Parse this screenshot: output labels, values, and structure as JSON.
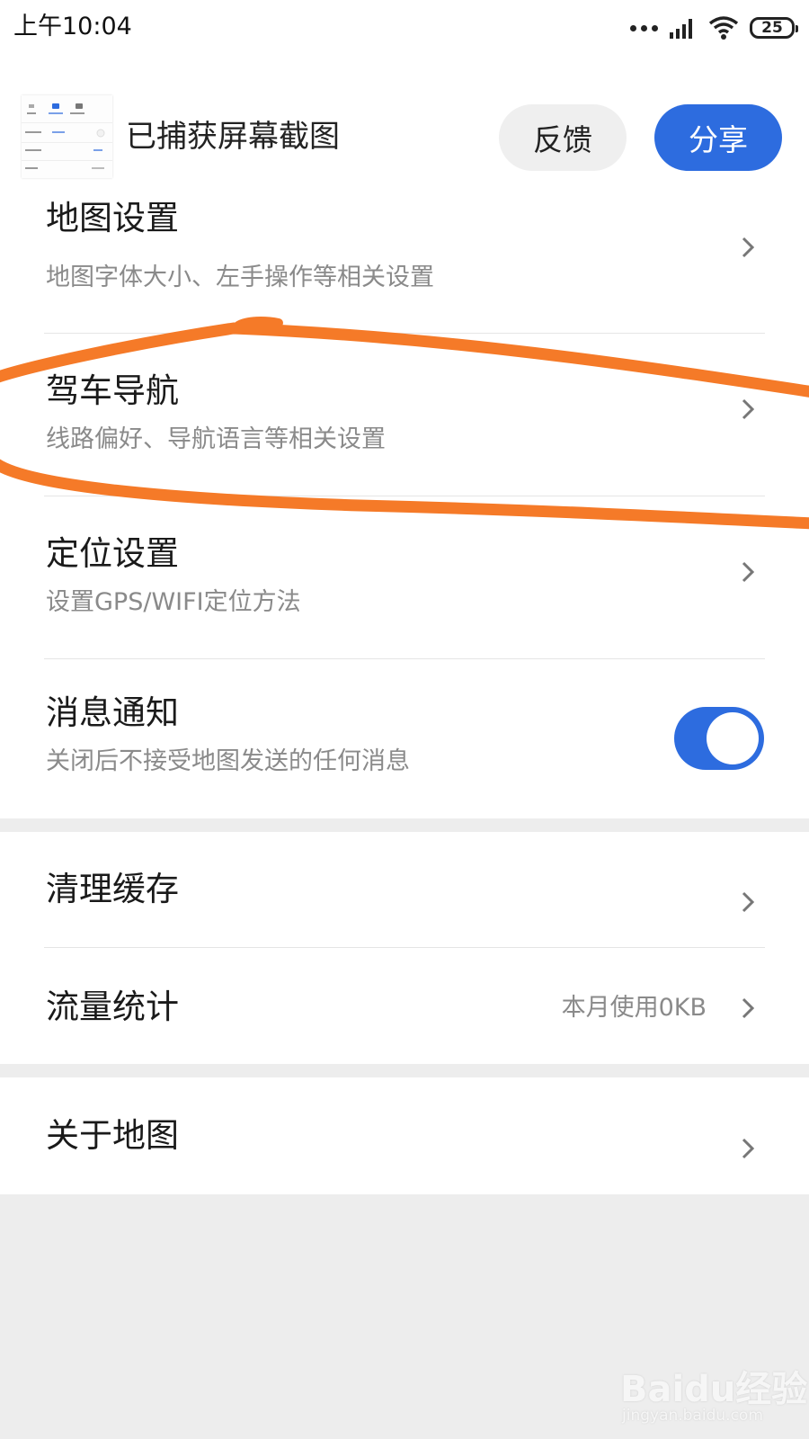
{
  "status_bar": {
    "time": "上午10:04",
    "battery": "25",
    "icons": [
      "more-dots-icon",
      "signal-icon",
      "wifi-icon",
      "battery-icon"
    ]
  },
  "capture_bar": {
    "title": "已捕获屏幕截图",
    "feedback_label": "反馈",
    "share_label": "分享"
  },
  "settings": {
    "map_settings": {
      "title": "地图设置",
      "subtitle": "地图字体大小、左手操作等相关设置"
    },
    "driving_nav": {
      "title": "驾车导航",
      "subtitle": "线路偏好、导航语言等相关设置"
    },
    "location": {
      "title": "定位设置",
      "subtitle": "设置GPS/WIFI定位方法"
    },
    "notifications": {
      "title": "消息通知",
      "subtitle": "关闭后不接受地图发送的任何消息",
      "enabled": true
    },
    "clear_cache": {
      "title": "清理缓存"
    },
    "data_usage": {
      "title": "流量统计",
      "value": "本月使用0KB"
    },
    "about": {
      "title": "关于地图"
    }
  },
  "colors": {
    "accent": "#2d6cdf",
    "annotation": "#f57a28",
    "background": "#ededed"
  },
  "watermark": {
    "brand": "Baidu经验",
    "url": "jingyan.baidu.com"
  }
}
